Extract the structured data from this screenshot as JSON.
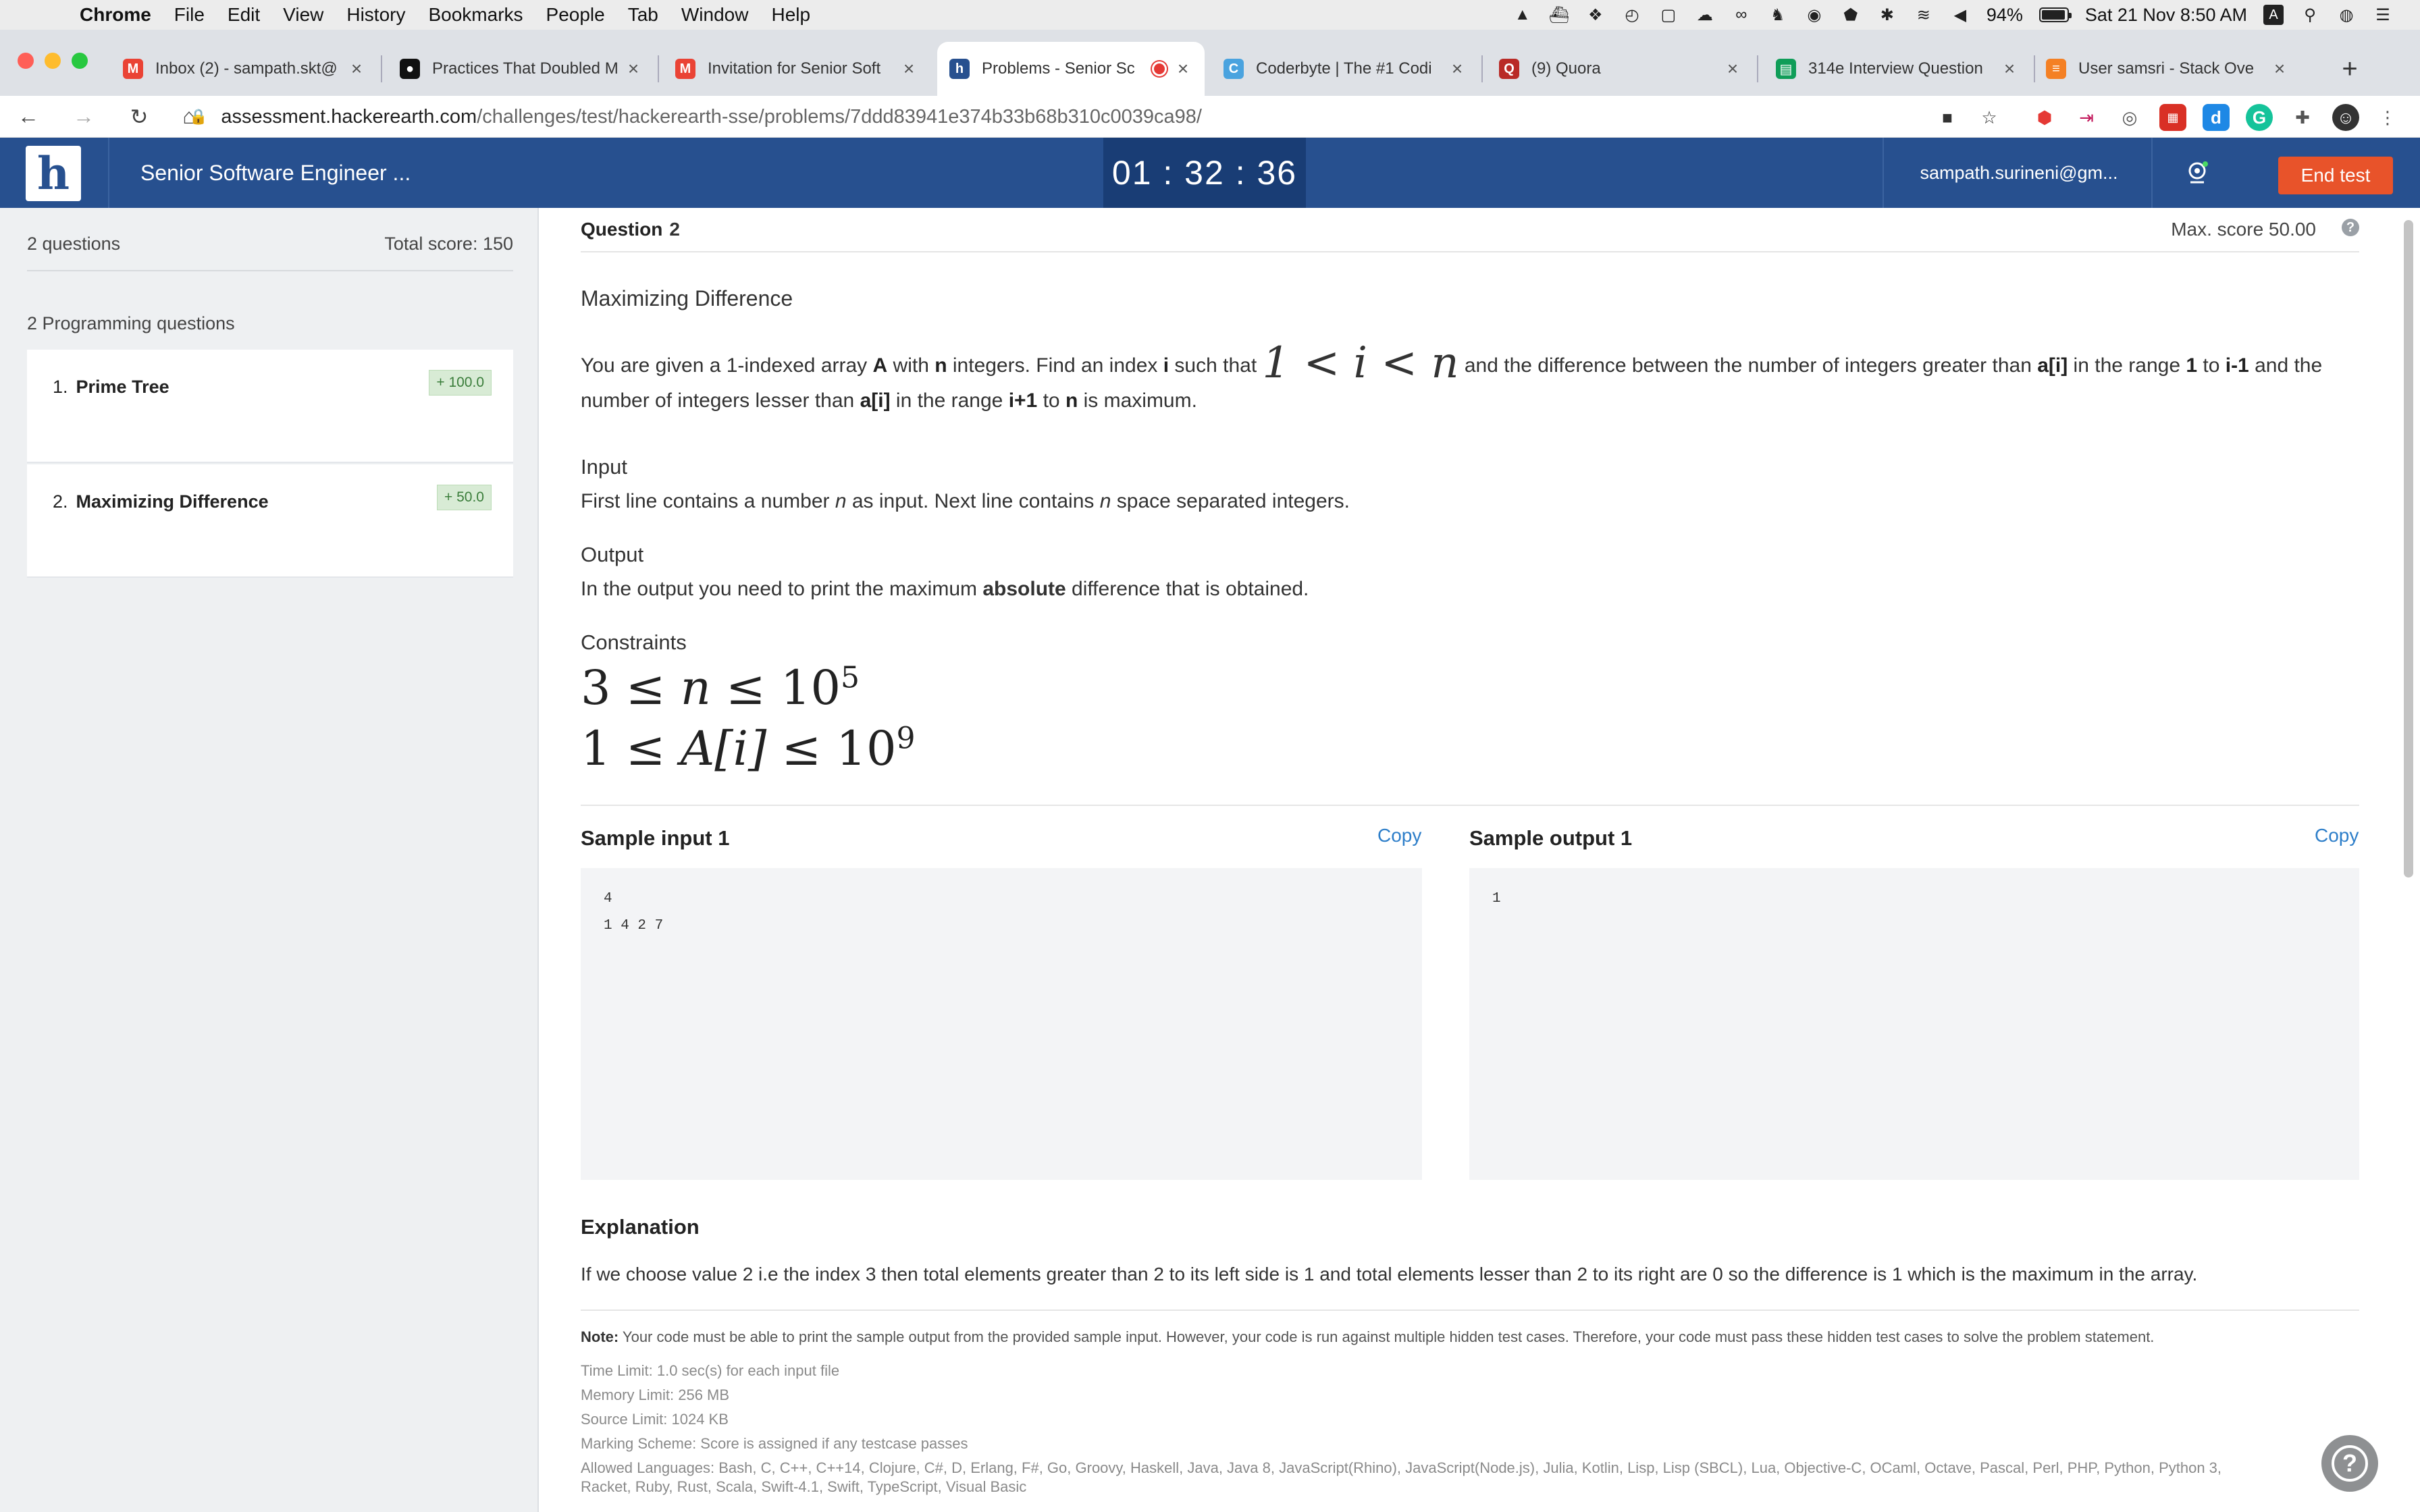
{
  "menubar": {
    "app_name": "Chrome",
    "menus": [
      "File",
      "Edit",
      "View",
      "History",
      "Bookmarks",
      "People",
      "Tab",
      "Window",
      "Help"
    ],
    "battery": "94%",
    "datetime": "Sat 21 Nov  8:50 AM",
    "input_source": "A"
  },
  "tabs": [
    {
      "title": "Inbox (2) - sampath.skt@",
      "icon": "gmail-icon",
      "color": "#ea4335",
      "glyph": "M"
    },
    {
      "title": "Practices That Doubled M",
      "icon": "medium-icon",
      "color": "#111111",
      "glyph": "●"
    },
    {
      "title": "Invitation for Senior Soft",
      "icon": "gmail-icon",
      "color": "#ea4335",
      "glyph": "M"
    },
    {
      "title": "Problems - Senior Sc",
      "icon": "hackerearth-icon",
      "color": "#27508f",
      "glyph": "h"
    },
    {
      "title": "Coderbyte | The #1 Codi",
      "icon": "coderbyte-icon",
      "color": "#4aa3df",
      "glyph": "C"
    },
    {
      "title": "(9) Quora",
      "icon": "quora-icon",
      "color": "#b92b27",
      "glyph": "Q"
    },
    {
      "title": "314e Interview Question",
      "icon": "sheets-icon",
      "color": "#0f9d58",
      "glyph": "▤"
    },
    {
      "title": "User samsri - Stack Ove",
      "icon": "stackoverflow-icon",
      "color": "#f48024",
      "glyph": "≡"
    }
  ],
  "address": {
    "host": "assessment.hackerearth.com",
    "path": "/challenges/test/hackerearth-sse/problems/7ddd83941e374b33b68b310c0039ca98/"
  },
  "header": {
    "test_title": "Senior Software Engineer ...",
    "timer": "01 : 32 : 36",
    "user_email": "sampath.surineni@gm...",
    "end_test_label": "End test"
  },
  "sidebar": {
    "questions_count": "2 questions",
    "total_score": "Total score: 150",
    "group_label": "2 Programming questions",
    "questions": [
      {
        "num": "1.",
        "title": "Prime Tree",
        "score": "+ 100.0"
      },
      {
        "num": "2.",
        "title": "Maximizing Difference",
        "score": "+ 50.0"
      }
    ]
  },
  "question": {
    "label": "Question",
    "number": "2",
    "max_score": "Max. score 50.00",
    "title": "Maximizing Difference",
    "statement": {
      "s1": "You are given a 1-indexed array ",
      "b1": "A",
      "s2": " with ",
      "b2": "n",
      "s3": " integers. Find an index ",
      "b3": "i",
      "s4": " such that ",
      "math": "1 < i < n",
      "s5": " and the difference between the number of integers greater than ",
      "b4": "a[i]",
      "s6": " in the range ",
      "b5": "1",
      "s7": " to ",
      "b6": "i-1",
      "s8": " and the number of integers lesser than ",
      "b7": "a[i]",
      "s9": " in the range ",
      "b8": "i+1",
      "s10": " to ",
      "b9": "n",
      "s11": " is maximum."
    },
    "input_heading": "Input",
    "input_text": {
      "a": "First line contains a number ",
      "v1": "n",
      "b": " as input. Next line contains ",
      "v2": "n",
      "c": " space separated integers."
    },
    "output_heading": "Output",
    "output_text": {
      "a": "In the output you need to print the maximum ",
      "b": "absolute",
      "c": " difference that is obtained."
    },
    "constraints_heading": "Constraints",
    "constraints": [
      {
        "lhs": "3 ≤ ",
        "var": "n",
        "rhs": " ≤ 10",
        "exp": "5"
      },
      {
        "lhs": "1 ≤ ",
        "var": "A[i]",
        "rhs": " ≤ 10",
        "exp": "9"
      }
    ],
    "sample_input_heading": "Sample input 1",
    "sample_output_heading": "Sample output 1",
    "copy_label": "Copy",
    "sample_input": "4\n1 4 2 7",
    "sample_output": "1",
    "explanation_heading": "Explanation",
    "explanation": "If we choose value 2 i.e the index 3 then total elements greater than 2 to its left side is 1 and total elements lesser than 2 to its right are 0 so the difference is 1 which is the maximum in the array.",
    "note_label": "Note:",
    "note": " Your code must be able to print the sample output from the provided sample input. However, your code is run against multiple hidden test cases. Therefore, your code must pass these hidden test cases to solve the problem statement.",
    "limits": [
      "Time Limit: 1.0 sec(s) for each input file",
      "Memory Limit: 256 MB",
      "Source Limit: 1024 KB",
      "Marking Scheme: Score is assigned if any testcase passes",
      "Allowed Languages: Bash, C, C++, C++14, Clojure, C#, D, Erlang, F#, Go, Groovy, Haskell, Java, Java 8, JavaScript(Rhino), JavaScript(Node.js), Julia, Kotlin, Lisp, Lisp (SBCL), Lua, Objective-C, OCaml, Octave, Pascal, Perl, PHP, Python, Python 3,",
      "Racket, Ruby, Rust, Scala, Swift-4.1, Swift, TypeScript, Visual Basic"
    ]
  }
}
